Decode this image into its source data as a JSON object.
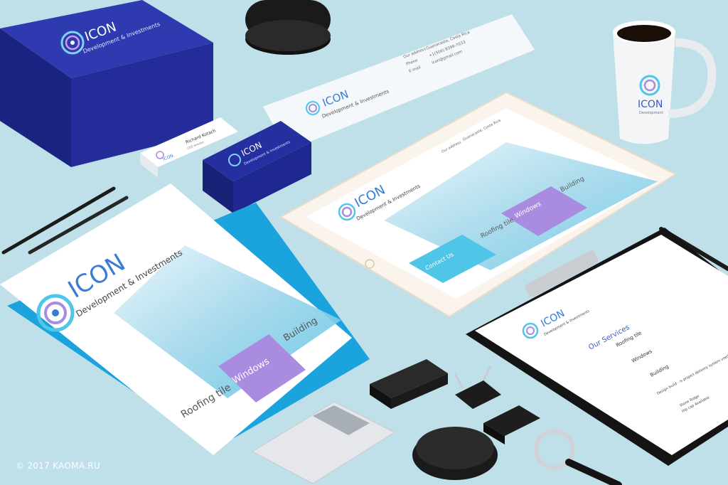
{
  "brand": {
    "name": "ICON",
    "tagline": "Development & Investments",
    "mug_tagline": "Development",
    "colors": {
      "navy": "#1e2a8c",
      "purple": "#a98be0",
      "cyan": "#4fc6e8",
      "blue": "#3a7bd5"
    }
  },
  "letterhead": {
    "contact_labels": [
      "Our address",
      "Phone",
      "E-mail"
    ],
    "contact_values": [
      "Guanacaste, Costa Rica",
      "+1(506) 8399-7033",
      "icon@gmail.com"
    ]
  },
  "business_card": {
    "person": "Richard Kotach",
    "role": "CEO director"
  },
  "tablet": {
    "services": [
      "Roofing tile",
      "Windows",
      "Building"
    ],
    "contact_button": "Contact Us"
  },
  "folder": {
    "services": [
      "Roofing tile",
      "Windows",
      "Building"
    ]
  },
  "clipboard_doc": {
    "heading": "Our Services",
    "items": [
      "Roofing tile",
      "Windows",
      "Building"
    ],
    "note": "Design build - is project delivery system used in the construction industry",
    "box_lines": [
      "Stone Ridge",
      "Hip cap Available"
    ]
  },
  "copyright": {
    "symbol": "©",
    "text": "2017 KAOMA.RU"
  }
}
